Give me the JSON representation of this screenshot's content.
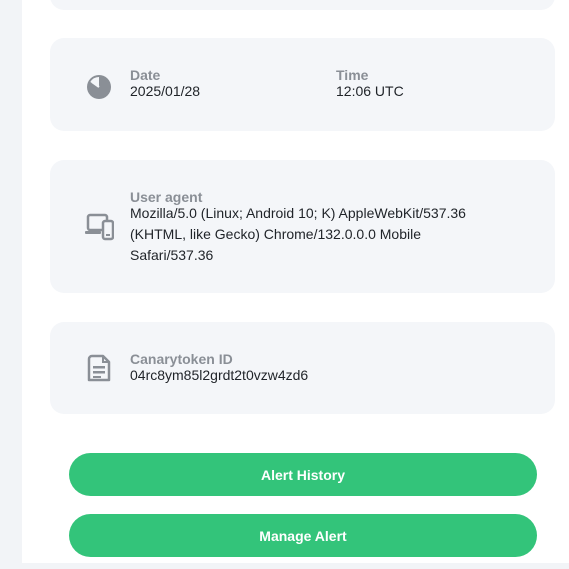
{
  "colors": {
    "accent": "#33c47a",
    "card_bg": "#f4f6f9",
    "label": "#8a8f96",
    "value": "#1f2328"
  },
  "date_time": {
    "icon": "clock-icon",
    "date_label": "Date",
    "date_value": "2025/01/28",
    "time_label": "Time",
    "time_value": "12:06 UTC"
  },
  "user_agent": {
    "icon": "devices-icon",
    "label": "User agent",
    "line1": "Mozilla/5.0 (Linux; Android 10; K) AppleWebKit/537.36",
    "line2": "(KHTML, like Gecko) Chrome/132.0.0.0 Mobile",
    "line3": "Safari/537.36"
  },
  "token": {
    "icon": "document-icon",
    "label": "Canarytoken ID",
    "value": "04rc8ym85l2grdt2t0vzw4zd6"
  },
  "buttons": {
    "alert_history": "Alert History",
    "manage_alert": "Manage Alert"
  }
}
